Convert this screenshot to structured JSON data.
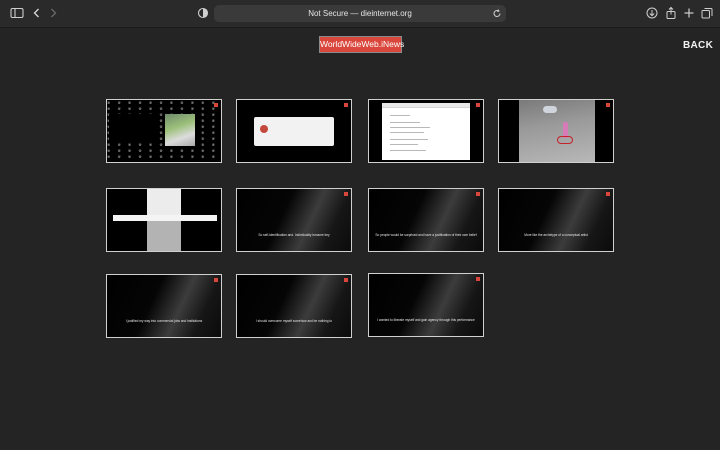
{
  "browser": {
    "address_text": "Not Secure — dieinternet.org"
  },
  "icons": {
    "sidebar": "sidebar-icon",
    "back": "chevron-left-icon",
    "forward": "chevron-right-icon",
    "shield": "privacy-shield-icon",
    "reload": "reload-icon",
    "download": "download-icon",
    "share": "share-icon",
    "new_tab": "plus-icon",
    "tabs": "tabs-overview-icon"
  },
  "page": {
    "logo_text": "WorldWideWeb.iNews",
    "back_label": "BACK"
  },
  "colors": {
    "brand_red": "#d9463b",
    "page_bg": "#242424"
  },
  "thumbnails": [
    {
      "caption": ""
    },
    {
      "caption": ""
    },
    {
      "caption": ""
    },
    {
      "caption": ""
    },
    {
      "caption": ""
    },
    {
      "caption": "So self-identification and. Individuality became key"
    },
    {
      "caption": "So people would be surprised and have a justification of their own belief"
    },
    {
      "caption": "More like the archetype of a conceptual artist"
    },
    {
      "caption": "I justified my way into commercial jobs and institutions"
    },
    {
      "caption": "I should overcome myself somehow and be nothing to"
    },
    {
      "caption": "I wanted to liberate myself and gain agency through this performance"
    }
  ]
}
